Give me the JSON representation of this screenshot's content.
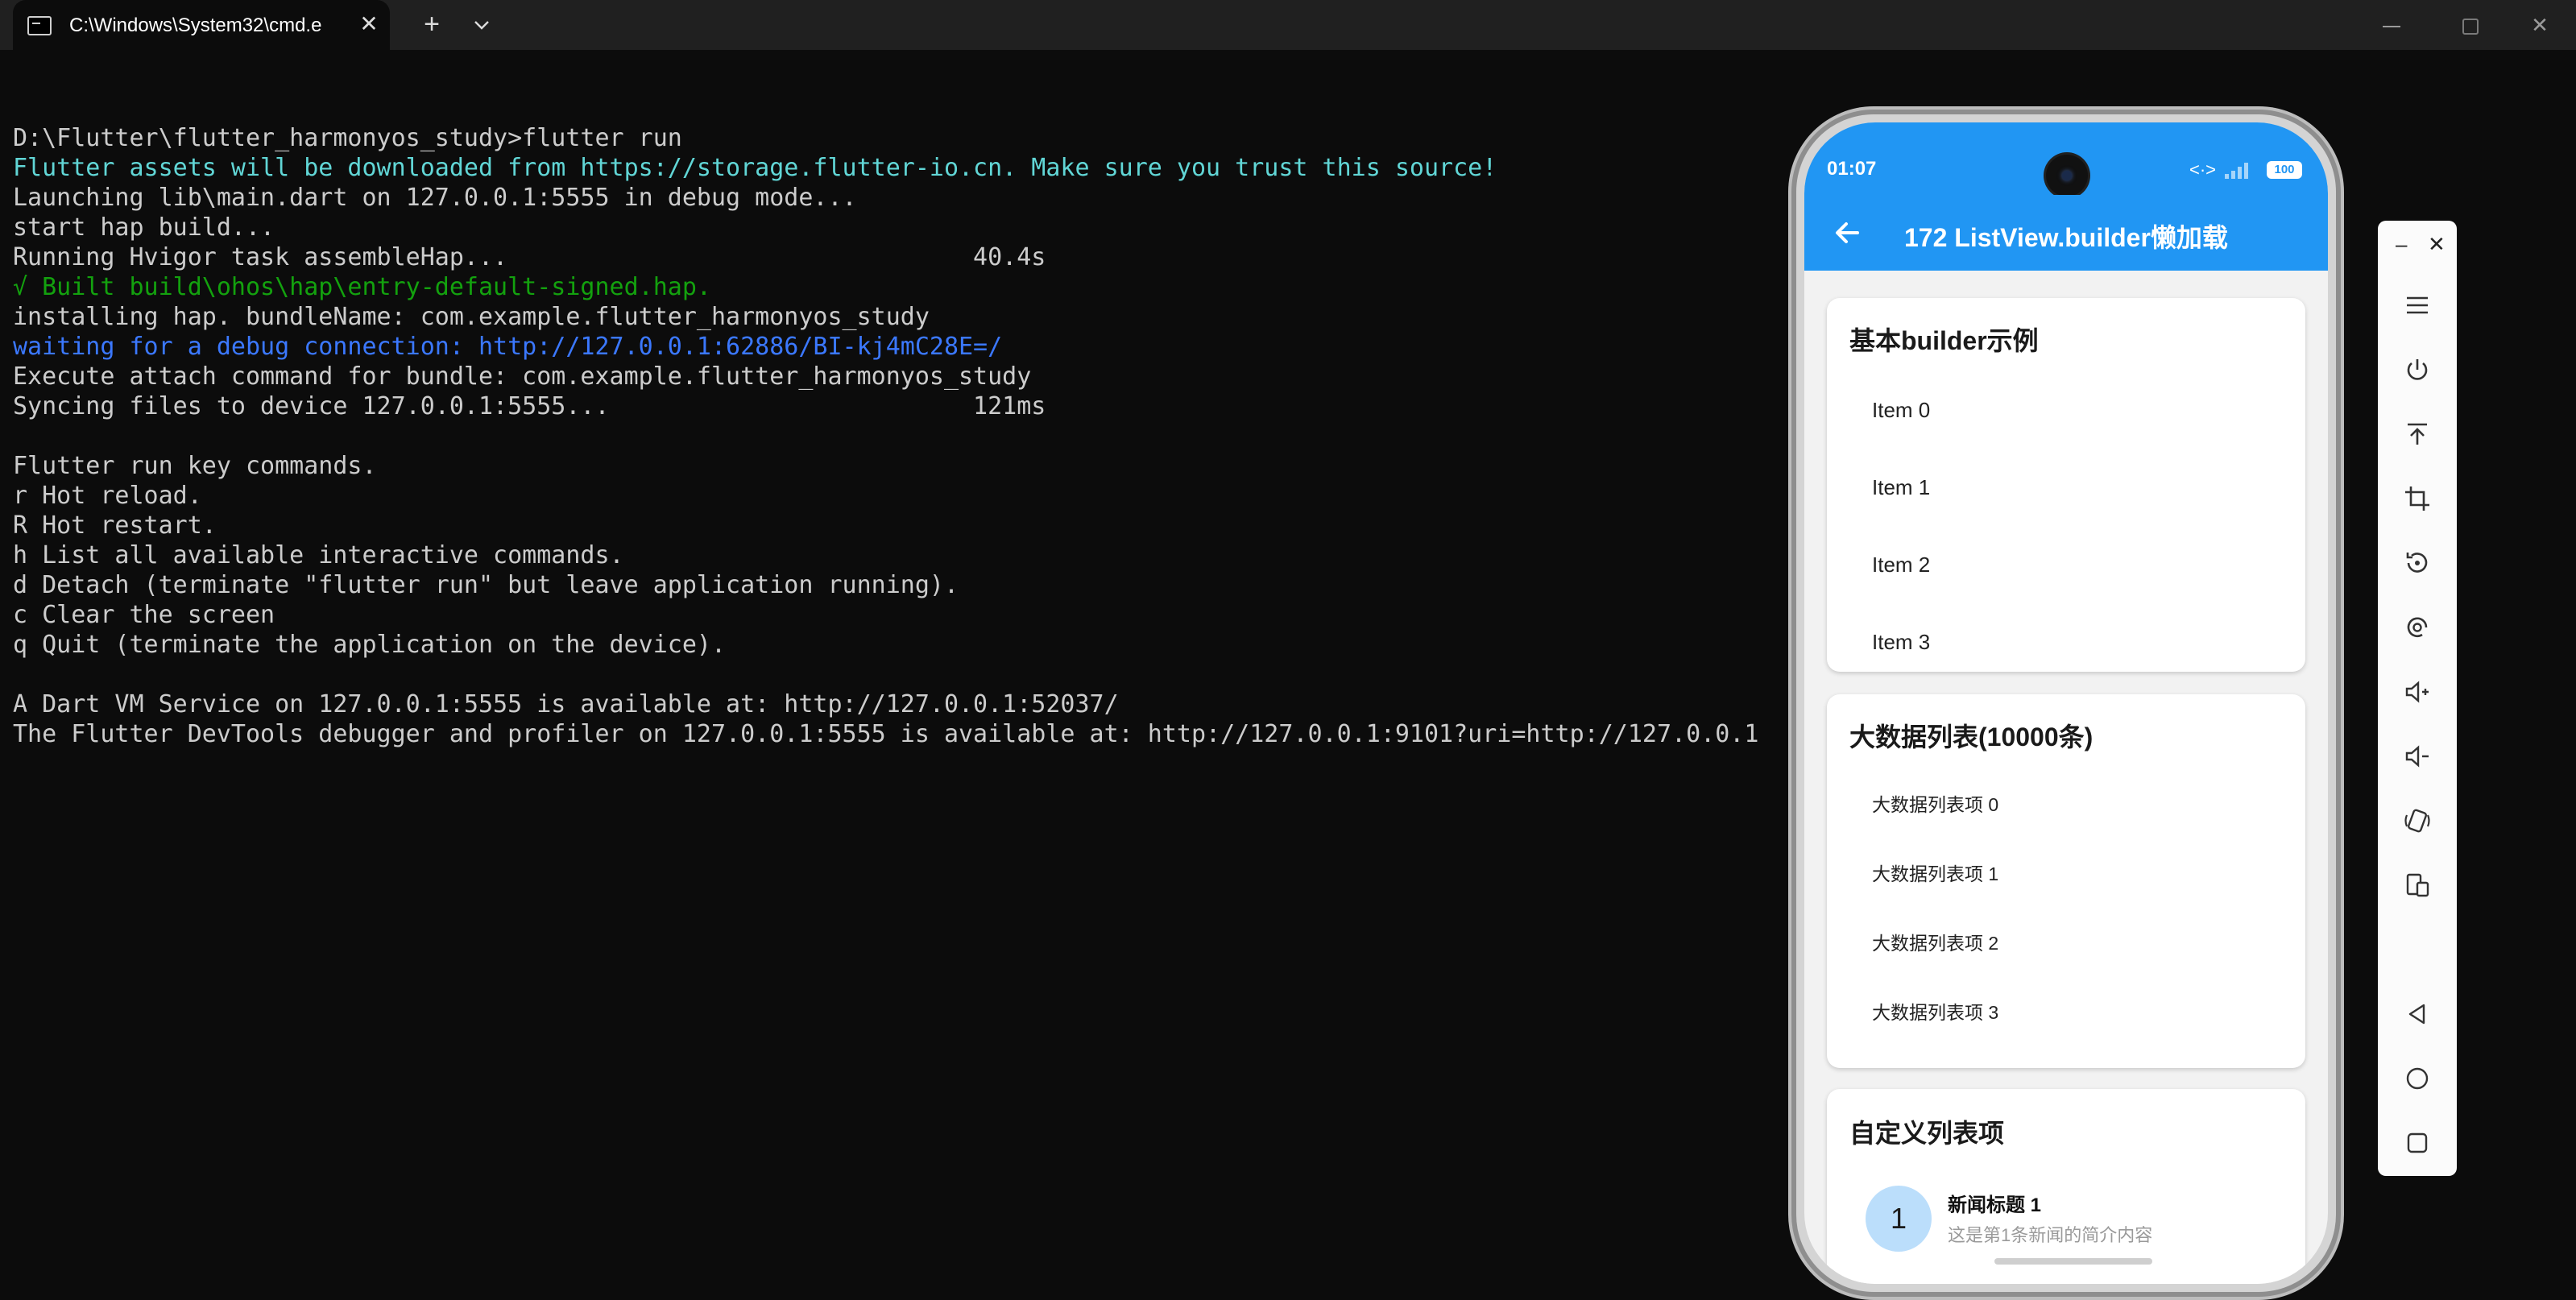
{
  "window": {
    "tab_title": "C:\\Windows\\System32\\cmd.e",
    "tab_close_glyph": "✕",
    "new_tab_glyph": "+",
    "tab_menu_glyph": "⌄",
    "close_glyph": "✕"
  },
  "terminal": {
    "lines": [
      {
        "text": "",
        "color": "default"
      },
      {
        "text": "D:\\Flutter\\flutter_harmonyos_study>flutter run",
        "color": "default"
      },
      {
        "text": "Flutter assets will be downloaded from https://storage.flutter-io.cn. Make sure you trust this source!",
        "color": "cyan"
      },
      {
        "text": "Launching lib\\main.dart on 127.0.0.1:5555 in debug mode...",
        "color": "default"
      },
      {
        "text": "start hap build...",
        "color": "default"
      },
      {
        "text": "Running Hvigor task assembleHap...                                40.4s",
        "color": "default"
      },
      {
        "text": "√ Built build\\ohos\\hap\\entry-default-signed.hap.",
        "color": "green"
      },
      {
        "text": "installing hap. bundleName: com.example.flutter_harmonyos_study",
        "color": "default"
      },
      {
        "text": "waiting for a debug connection: http://127.0.0.1:62886/BI-kj4mC28E=/",
        "color": "blue"
      },
      {
        "text": "Execute attach command for bundle: com.example.flutter_harmonyos_study",
        "color": "default"
      },
      {
        "text": "Syncing files to device 127.0.0.1:5555...                         121ms",
        "color": "default"
      },
      {
        "text": "",
        "color": "default"
      },
      {
        "text": "Flutter run key commands.",
        "color": "default"
      },
      {
        "text": "r Hot reload.",
        "color": "default"
      },
      {
        "text": "R Hot restart.",
        "color": "default"
      },
      {
        "text": "h List all available interactive commands.",
        "color": "default"
      },
      {
        "text": "d Detach (terminate \"flutter run\" but leave application running).",
        "color": "default"
      },
      {
        "text": "c Clear the screen",
        "color": "default"
      },
      {
        "text": "q Quit (terminate the application on the device).",
        "color": "default"
      },
      {
        "text": "",
        "color": "default"
      },
      {
        "text": "A Dart VM Service on 127.0.0.1:5555 is available at: http://127.0.0.1:52037/",
        "color": "default"
      },
      {
        "text": "The Flutter DevTools debugger and profiler on 127.0.0.1:5555 is available at: http://127.0.0.1:9101?uri=http://127.0.0.1",
        "color": "default"
      }
    ]
  },
  "phone": {
    "status": {
      "time": "01:07",
      "battery": "100",
      "wifi_glyph": "<·>"
    },
    "appbar": {
      "title": "172 ListView.builder懒加载"
    },
    "card_basic": {
      "title": "基本builder示例",
      "items": [
        "Item 0",
        "Item 1",
        "Item 2",
        "Item 3"
      ]
    },
    "card_big": {
      "title": "大数据列表(10000条)",
      "items": [
        "大数据列表项 0",
        "大数据列表项 1",
        "大数据列表项 2",
        "大数据列表项 3"
      ]
    },
    "card_custom": {
      "title": "自定义列表项",
      "avatar": "1",
      "news_title": "新闻标题 1",
      "news_subtitle": "这是第1条新闻的简介内容"
    }
  },
  "emulator_toolbar": {
    "minimize_glyph": "–",
    "close_glyph": "✕",
    "buttons": [
      "menu-icon",
      "power-icon",
      "pin-top-icon",
      "crop-icon",
      "rotate-icon",
      "screenshot-icon",
      "volume-up-icon",
      "volume-down-icon",
      "shake-icon",
      "multi-device-icon",
      "back-icon",
      "home-icon",
      "recents-icon"
    ]
  },
  "colors": {
    "terminal_bg": "#0c0c0c",
    "terminal_text": "#cccccc",
    "cyan": "#61d6d6",
    "green": "#13a10e",
    "blue": "#3b78ff",
    "app_primary": "#2196f3",
    "avatar_bg": "#bbdefb"
  }
}
